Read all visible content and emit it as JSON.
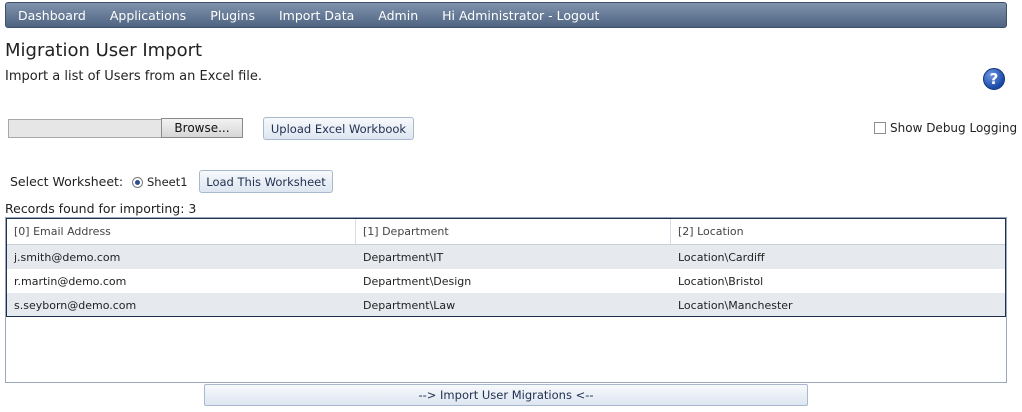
{
  "nav": {
    "items": [
      {
        "label": "Dashboard"
      },
      {
        "label": "Applications"
      },
      {
        "label": "Plugins"
      },
      {
        "label": "Import Data"
      },
      {
        "label": "Admin"
      },
      {
        "label": "Hi Administrator - Logout"
      }
    ]
  },
  "page": {
    "title": "Migration User Import",
    "subtitle": "Import a list of Users from an Excel file."
  },
  "help": {
    "icon": "help-icon",
    "glyph": "?"
  },
  "upload": {
    "file_value": "",
    "browse_label": "Browse...",
    "upload_label": "Upload Excel Workbook",
    "debug_label": "Show Debug Logging",
    "debug_checked": false
  },
  "worksheet": {
    "label": "Select Worksheet:",
    "options": [
      {
        "label": "Sheet1",
        "selected": true
      }
    ],
    "load_label": "Load This Worksheet"
  },
  "records": {
    "text": "Records found for importing: 3"
  },
  "grid": {
    "headers": [
      "[0] Email Address",
      "[1] Department",
      "[2] Location"
    ],
    "rows": [
      [
        "j.smith@demo.com",
        "Department\\IT",
        "Location\\Cardiff"
      ],
      [
        "r.martin@demo.com",
        "Department\\Design",
        "Location\\Bristol"
      ],
      [
        "s.seyborn@demo.com",
        "Department\\Law",
        "Location\\Manchester"
      ]
    ]
  },
  "import": {
    "label": "--> Import User Migrations <--"
  },
  "colors": {
    "nav_top": "#7f93ad",
    "nav_bottom": "#4f6482",
    "help_blue": "#1a4aa8",
    "grid_border": "#1f2f4f"
  }
}
